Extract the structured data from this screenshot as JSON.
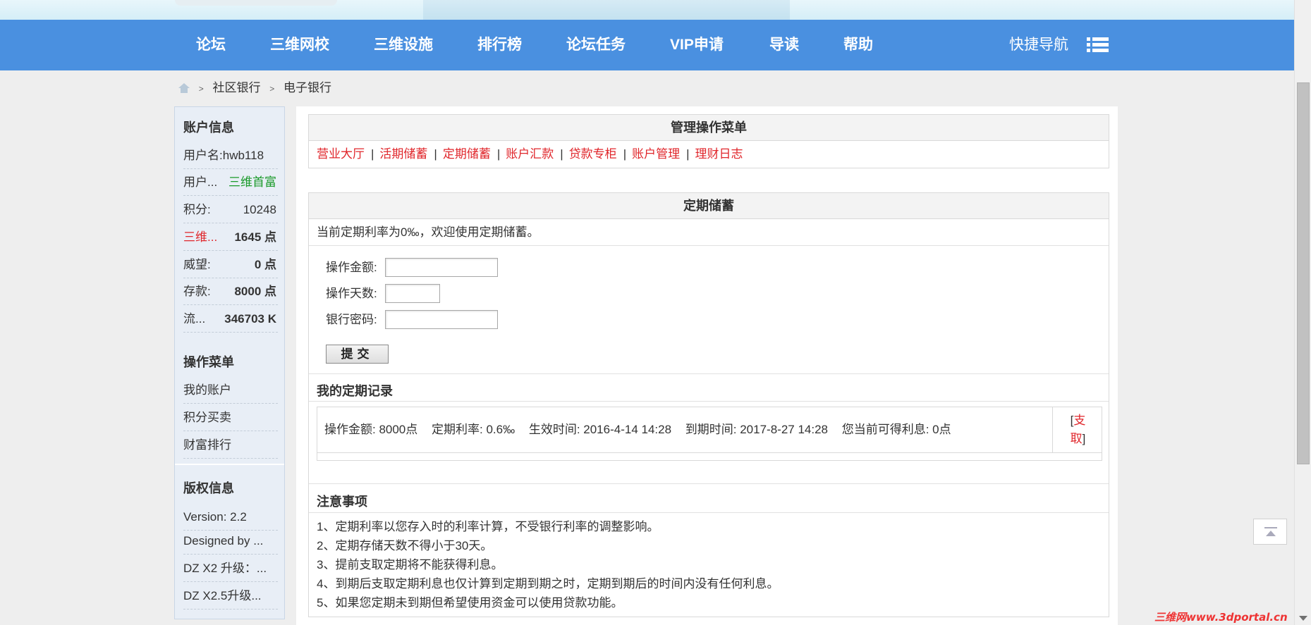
{
  "nav": {
    "items": [
      "论坛",
      "三维网校",
      "三维设施",
      "排行榜",
      "论坛任务",
      "VIP申请",
      "导读",
      "帮助"
    ],
    "quick_nav": "快捷导航"
  },
  "breadcrumb": [
    "社区银行",
    "电子银行"
  ],
  "sidebar": {
    "account_title": "账户信息",
    "rows": [
      {
        "label": "用户名:",
        "value": "hwb118"
      },
      {
        "label": "用户...",
        "value": "三维首富"
      },
      {
        "label": "积分:",
        "value": "10248"
      },
      {
        "label": "三维...",
        "value": "1645 点"
      },
      {
        "label": "威望:",
        "value": "0 点"
      },
      {
        "label": "存款:",
        "value": "8000 点"
      },
      {
        "label": "流...",
        "value": "346703 K"
      }
    ],
    "menu_title": "操作菜单",
    "menu_items": [
      "我的账户",
      "积分买卖",
      "财富排行"
    ],
    "copyright_title": "版权信息",
    "copyright_items": [
      "Version: 2.2",
      "Designed by ...",
      "DZ X2 升级：...",
      "DZ X2.5升级..."
    ]
  },
  "manage_menu": {
    "title": "管理操作菜单",
    "links": [
      "营业大厅",
      "活期储蓄",
      "定期储蓄",
      "账户汇款",
      "贷款专柜",
      "账户管理",
      "理财日志"
    ]
  },
  "fixed_deposit": {
    "title": "定期储蓄",
    "intro": "当前定期利率为0‰，欢迎使用定期储蓄。",
    "fields": {
      "amount_label": "操作金额:",
      "amount_value": "",
      "days_label": "操作天数:",
      "days_value": "",
      "password_label": "银行密码:",
      "password_value": ""
    },
    "submit": "提交",
    "records_title": "我的定期记录",
    "record": {
      "amount": "操作金额: 8000点",
      "rate": "定期利率: 0.6‰",
      "start": "生效时间: 2016-4-14 14:28",
      "end": "到期时间: 2017-8-27 14:28",
      "interest": "您当前可得利息: 0点",
      "action_open": "[",
      "action_text_1": "支",
      "action_text_2": "取",
      "action_close": "]"
    }
  },
  "notes": {
    "title": "注意事项",
    "items": [
      "1、定期利率以您存入时的利率计算，不受银行利率的调整影响。",
      "2、定期存储天数不得小于30天。",
      "3、提前支取定期将不能获得利息。",
      "4、到期后支取定期利息也仅计算到定期到期之时，定期到期后的时间内没有任何利息。",
      "5、如果您定期未到期但希望使用资金可以使用贷款功能。"
    ]
  },
  "watermark": "三维网www.3dportal.cn",
  "colors": {
    "nav_bg": "#4a90e0",
    "link_red": "#e0262b",
    "title_green": "#1a9a2a"
  }
}
